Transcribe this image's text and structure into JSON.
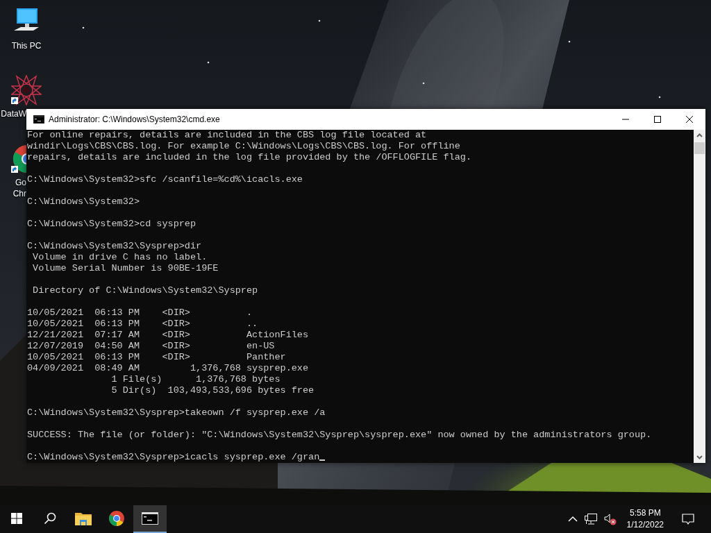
{
  "desktop": {
    "icons": [
      {
        "kind": "computer",
        "label_lines": [
          "This PC"
        ]
      },
      {
        "kind": "mandala",
        "label_lines": [
          "DataW"
        ]
      },
      {
        "kind": "browser",
        "label_lines": [
          "Go",
          "Chr"
        ]
      }
    ]
  },
  "window": {
    "title": "Administrator: C:\\Windows\\System32\\cmd.exe",
    "console": {
      "cursor": true,
      "blocks": [
        [
          "For online repairs, details are included in the CBS log file located at",
          "windir\\Logs\\CBS\\CBS.log. For example C:\\Windows\\Logs\\CBS\\CBS.log. For offline",
          "repairs, details are included in the log file provided by the /OFFLOGFILE flag."
        ],
        [
          "C:\\Windows\\System32>sfc /scanfile=%cd%\\icacls.exe"
        ],
        [
          "C:\\Windows\\System32>"
        ],
        [
          "C:\\Windows\\System32>cd sysprep"
        ],
        [
          "C:\\Windows\\System32\\Sysprep>dir",
          " Volume in drive C has no label.",
          " Volume Serial Number is 90BE-19FE"
        ],
        [
          " Directory of C:\\Windows\\System32\\Sysprep"
        ],
        [
          "10/05/2021  06:13 PM    <DIR>          .",
          "10/05/2021  06:13 PM    <DIR>          ..",
          "12/21/2021  07:17 AM    <DIR>          ActionFiles",
          "12/07/2019  04:50 AM    <DIR>          en-US",
          "10/05/2021  06:13 PM    <DIR>          Panther",
          "04/09/2021  08:49 AM         1,376,768 sysprep.exe",
          "               1 File(s)      1,376,768 bytes",
          "               5 Dir(s)  103,493,533,696 bytes free"
        ],
        [
          "C:\\Windows\\System32\\Sysprep>takeown /f sysprep.exe /a"
        ],
        [
          "SUCCESS: The file (or folder): \"C:\\Windows\\System32\\Sysprep\\sysprep.exe\" now owned by the administrators group."
        ],
        [
          "C:\\Windows\\System32\\Sysprep>icacls sysprep.exe /gran"
        ]
      ]
    }
  },
  "taskbar": {
    "buttons": [
      {
        "kind": "start",
        "selected": false
      },
      {
        "kind": "search",
        "selected": false
      },
      {
        "kind": "explorer",
        "selected": false
      },
      {
        "kind": "browser",
        "selected": false
      },
      {
        "kind": "console",
        "selected": true
      }
    ],
    "tray": {
      "volume_muted": true,
      "time": "5:58 PM",
      "date": "1/12/2022"
    }
  }
}
